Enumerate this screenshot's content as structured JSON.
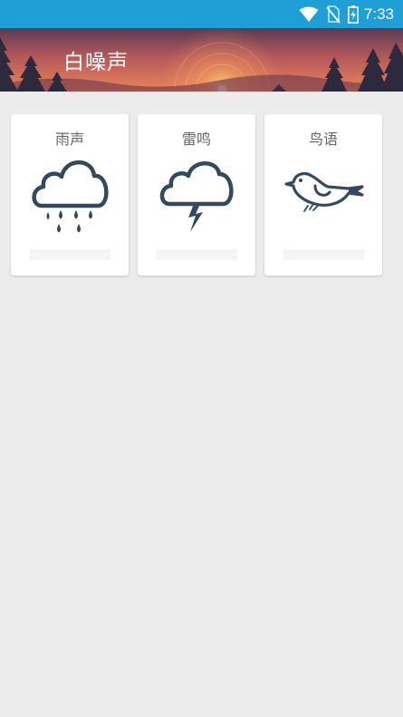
{
  "status_bar": {
    "time": "7:33",
    "icons": [
      "wifi-icon",
      "no-sim-icon",
      "battery-charging-icon"
    ],
    "color": "#1ea0d6"
  },
  "header": {
    "title": "白噪声"
  },
  "cards": [
    {
      "title": "雨声",
      "icon": "rain-cloud-icon"
    },
    {
      "title": "雷鸣",
      "icon": "thunder-cloud-icon"
    },
    {
      "title": "鸟语",
      "icon": "bird-icon"
    }
  ],
  "colors": {
    "icon": "#34495e",
    "background": "#ececec"
  }
}
